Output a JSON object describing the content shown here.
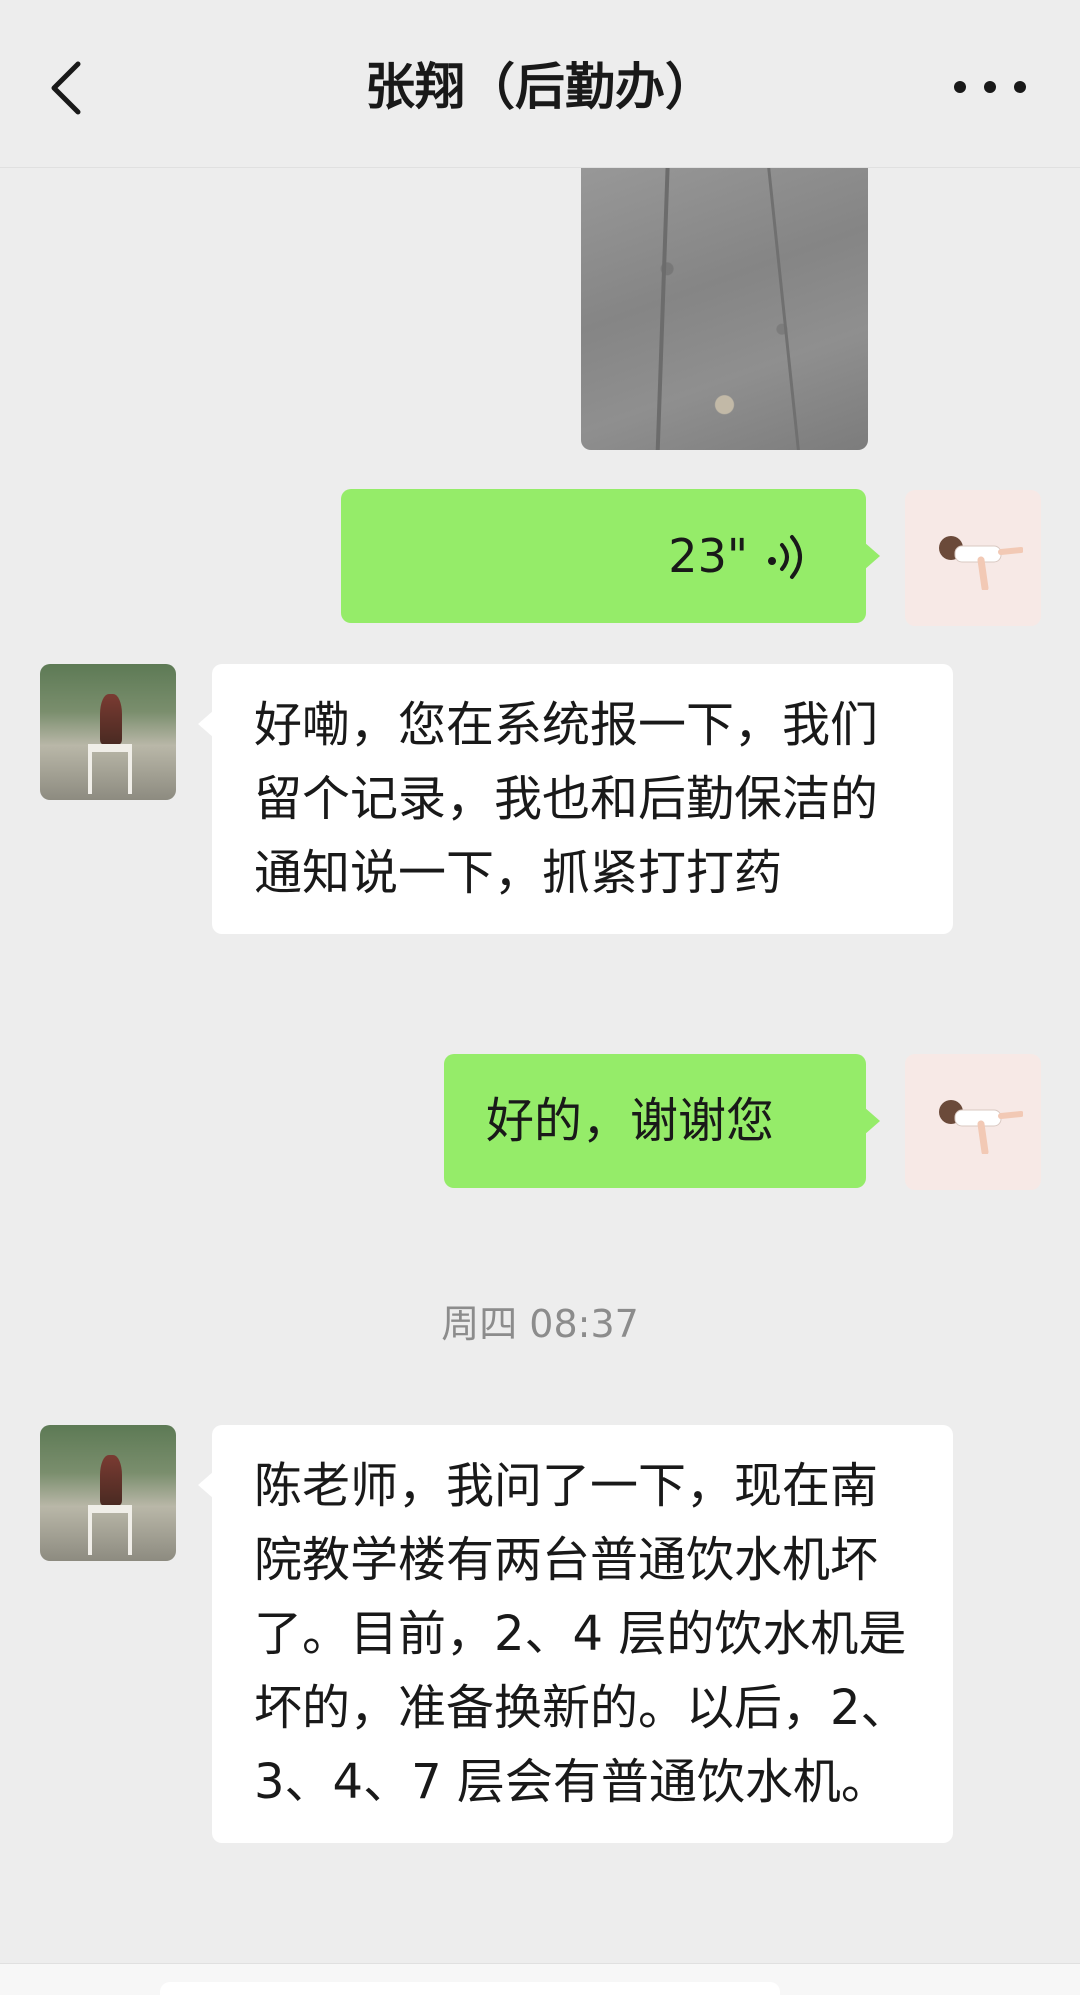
{
  "header": {
    "title": "张翔（后勤办）",
    "back_icon": "chevron-left-icon",
    "more_icon": "ellipsis-icon"
  },
  "messages": [
    {
      "type": "image",
      "sender": "self",
      "description_icon": "photo"
    },
    {
      "type": "voice",
      "sender": "self",
      "duration": "23\""
    },
    {
      "type": "text",
      "sender": "other",
      "text": "好嘞，您在系统报一下，我们留个记录，我也和后勤保洁的通知说一下，抓紧打打药"
    },
    {
      "type": "text",
      "sender": "self",
      "text": "好的，谢谢您"
    },
    {
      "type": "time",
      "text": "周四 08:37"
    },
    {
      "type": "text",
      "sender": "other",
      "text": "陈老师，我问了一下，现在南院教学楼有两台普通饮水机坏了。目前，2、4 层的饮水机是坏的，准备换新的。以后，2、3、4、7 层会有普通饮水机。"
    }
  ],
  "colors": {
    "background": "#EDEDED",
    "self_bubble": "#95EC69",
    "other_bubble": "#FFFFFF"
  }
}
